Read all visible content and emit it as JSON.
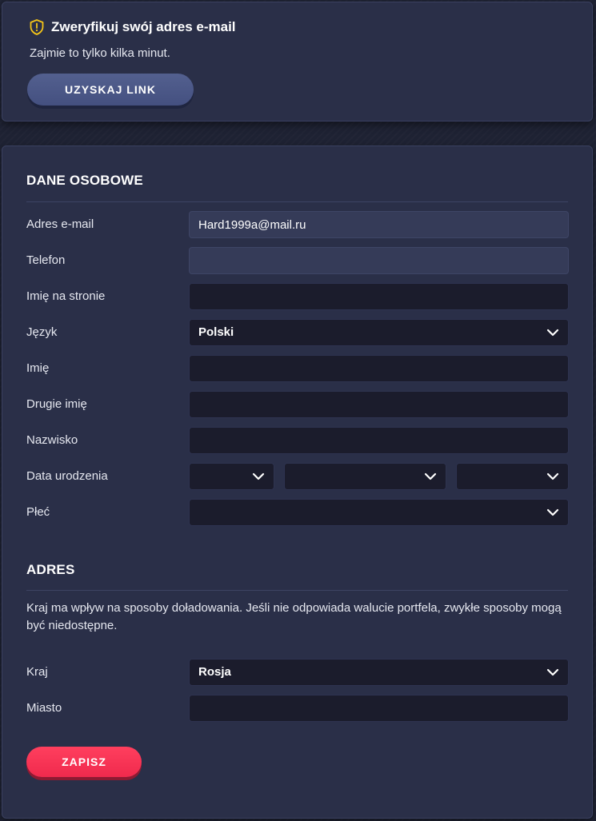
{
  "verify": {
    "title": "Zweryfikuj swój adres e-mail",
    "subtitle": "Zajmie to tylko kilka minut.",
    "button": "UZYSKAJ LINK",
    "icon": "shield-warning-icon",
    "icon_color": "#f5c518"
  },
  "personal": {
    "title": "DANE OSOBOWE",
    "email_label": "Adres e-mail",
    "email_value": "Hard1999a@mail.ru",
    "phone_label": "Telefon",
    "phone_value": "",
    "nickname_label": "Imię na stronie",
    "nickname_value": "",
    "language_label": "Język",
    "language_value": "Polski",
    "first_name_label": "Imię",
    "first_name_value": "",
    "middle_name_label": "Drugie imię",
    "middle_name_value": "",
    "last_name_label": "Nazwisko",
    "last_name_value": "",
    "birth_label": "Data urodzenia",
    "birth_day": "",
    "birth_month": "",
    "birth_year": "",
    "gender_label": "Płeć",
    "gender_value": ""
  },
  "address": {
    "title": "ADRES",
    "note": "Kraj ma wpływ na sposoby doładowania. Jeśli nie odpowiada walucie portfela, zwykłe sposoby mogą być niedostępne.",
    "country_label": "Kraj",
    "country_value": "Rosja",
    "city_label": "Miasto",
    "city_value": ""
  },
  "save_button": "ZAPISZ",
  "colors": {
    "background": "#1e2233",
    "card": "#2a2f48",
    "input": "#1b1c2c",
    "readonly_input": "#353b58",
    "save_button": "#ff3f5e",
    "link_button": "#4c5888"
  }
}
